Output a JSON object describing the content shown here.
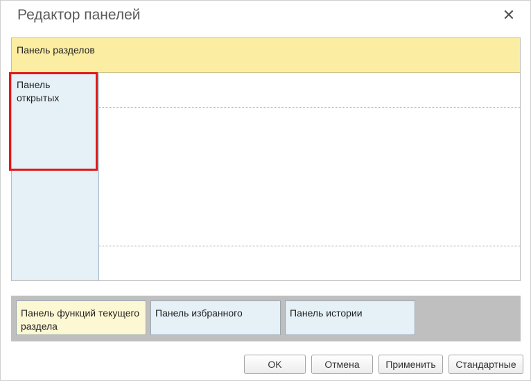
{
  "dialog": {
    "title": "Редактор панелей",
    "close_glyph": "✕"
  },
  "workspace": {
    "sections_panel": "Панель разделов",
    "open_panel": "Панель открытых"
  },
  "bottom_panels": [
    {
      "label": "Панель функций текущего раздела"
    },
    {
      "label": "Панель избранного"
    },
    {
      "label": "Панель истории"
    }
  ],
  "buttons": {
    "ok": "OK",
    "cancel": "Отмена",
    "apply": "Применить",
    "standard": "Стандартные"
  },
  "colors": {
    "sections_panel": "#fbeea3",
    "open_panel": "#e5f0f7",
    "functions_panel": "#fdf8d4",
    "highlight": "#e01818"
  }
}
